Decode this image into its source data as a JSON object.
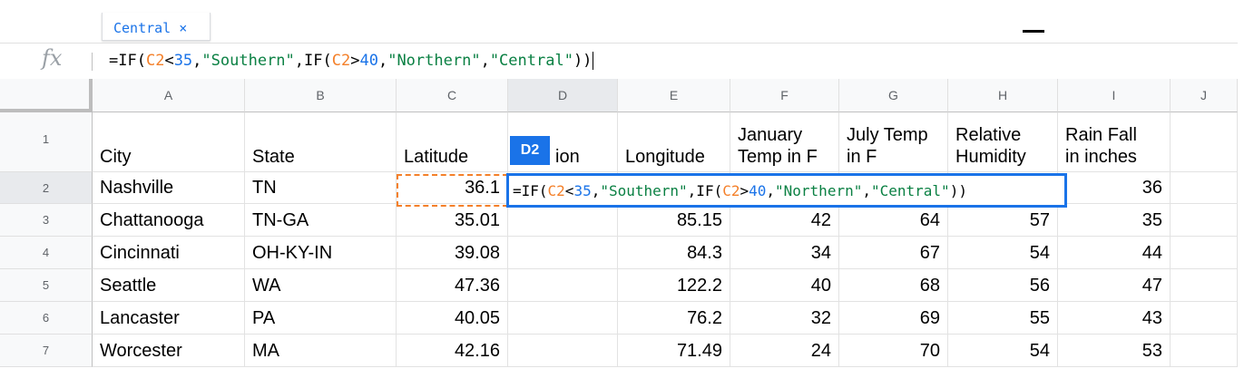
{
  "tooltip": {
    "text": "Central ×"
  },
  "formula_bar": {
    "fx_label": "fx",
    "formula_tokens": [
      {
        "t": "=IF(",
        "k": "def"
      },
      {
        "t": "C2",
        "k": "ref"
      },
      {
        "t": "<",
        "k": "def"
      },
      {
        "t": "35",
        "k": "num"
      },
      {
        "t": ",",
        "k": "def"
      },
      {
        "t": "\"Southern\"",
        "k": "str"
      },
      {
        "t": ",IF(",
        "k": "def"
      },
      {
        "t": "C2",
        "k": "ref"
      },
      {
        "t": ">",
        "k": "def"
      },
      {
        "t": "40",
        "k": "num"
      },
      {
        "t": ",",
        "k": "def"
      },
      {
        "t": "\"Northern\"",
        "k": "str"
      },
      {
        "t": ",",
        "k": "def"
      },
      {
        "t": "\"Central\"",
        "k": "str"
      },
      {
        "t": "))",
        "k": "def"
      }
    ]
  },
  "colors": {
    "accent": "#1a73e8",
    "reference": "#f4802a",
    "string": "#0a8043",
    "number": "#1a73e8"
  },
  "active_cell_label": "D2",
  "columns": [
    "A",
    "B",
    "C",
    "D",
    "E",
    "F",
    "G",
    "H",
    "I",
    "J"
  ],
  "rows": [
    {
      "num": "1",
      "cells": [
        [
          "City"
        ],
        [
          "State"
        ],
        [
          "Latitude"
        ],
        [
          "ion"
        ],
        [
          "Longitude"
        ],
        [
          "January",
          "Temp in F"
        ],
        [
          "July Temp",
          "in F"
        ],
        [
          "Relative",
          "Humidity"
        ],
        [
          "Rain Fall",
          "in inches"
        ],
        [
          ""
        ]
      ]
    },
    {
      "num": "2",
      "cells": [
        [
          "Nashville"
        ],
        [
          "TN"
        ],
        [
          "36.1"
        ],
        [
          ""
        ],
        [
          ""
        ],
        [
          ""
        ],
        [
          ""
        ],
        [
          ""
        ],
        [
          "36"
        ],
        [
          ""
        ]
      ]
    },
    {
      "num": "3",
      "cells": [
        [
          "Chattanooga"
        ],
        [
          "TN-GA"
        ],
        [
          "35.01"
        ],
        [
          ""
        ],
        [
          "85.15"
        ],
        [
          "42"
        ],
        [
          "64"
        ],
        [
          "57"
        ],
        [
          "35"
        ],
        [
          ""
        ]
      ]
    },
    {
      "num": "4",
      "cells": [
        [
          "Cincinnati"
        ],
        [
          "OH-KY-IN"
        ],
        [
          "39.08"
        ],
        [
          ""
        ],
        [
          "84.3"
        ],
        [
          "34"
        ],
        [
          "67"
        ],
        [
          "54"
        ],
        [
          "44"
        ],
        [
          ""
        ]
      ]
    },
    {
      "num": "5",
      "cells": [
        [
          "Seattle"
        ],
        [
          "WA"
        ],
        [
          "47.36"
        ],
        [
          ""
        ],
        [
          "122.2"
        ],
        [
          "40"
        ],
        [
          "68"
        ],
        [
          "56"
        ],
        [
          "47"
        ],
        [
          ""
        ]
      ]
    },
    {
      "num": "6",
      "cells": [
        [
          "Lancaster"
        ],
        [
          "PA"
        ],
        [
          "40.05"
        ],
        [
          ""
        ],
        [
          "76.2"
        ],
        [
          "32"
        ],
        [
          "69"
        ],
        [
          "55"
        ],
        [
          "43"
        ],
        [
          ""
        ]
      ]
    },
    {
      "num": "7",
      "cells": [
        [
          "Worcester"
        ],
        [
          "MA"
        ],
        [
          "42.16"
        ],
        [
          ""
        ],
        [
          "71.49"
        ],
        [
          "24"
        ],
        [
          "70"
        ],
        [
          "54"
        ],
        [
          "53"
        ],
        [
          ""
        ]
      ]
    }
  ]
}
